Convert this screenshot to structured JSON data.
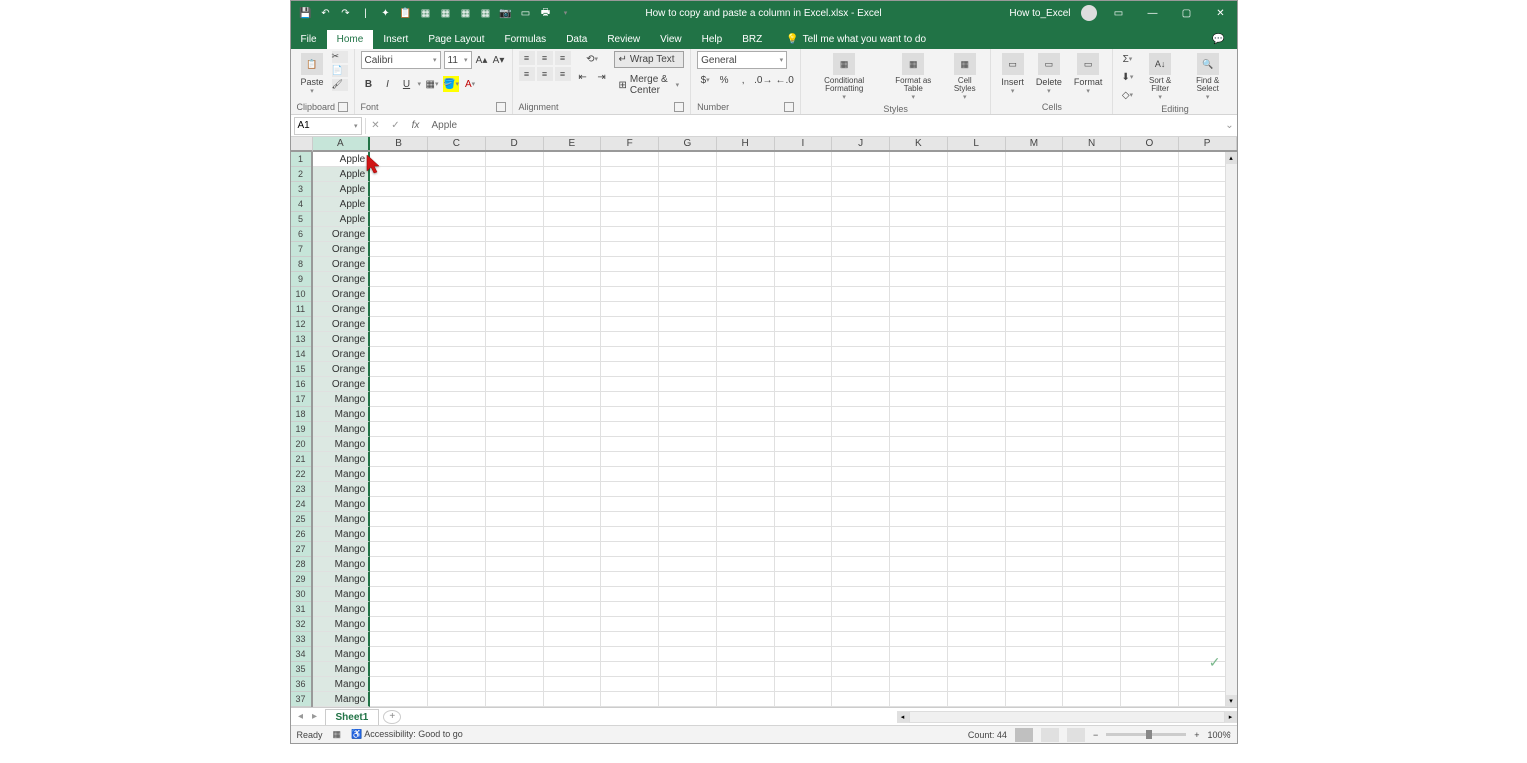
{
  "title_bar": {
    "document_title": "How to copy and paste a column in Excel.xlsx - Excel",
    "user_name": "How to_Excel"
  },
  "tabs": {
    "file": "File",
    "home": "Home",
    "insert": "Insert",
    "page_layout": "Page Layout",
    "formulas": "Formulas",
    "data": "Data",
    "review": "Review",
    "view": "View",
    "help": "Help",
    "brz": "BRZ",
    "tell_me": "Tell me what you want to do"
  },
  "ribbon": {
    "clipboard": {
      "label": "Clipboard",
      "paste": "Paste"
    },
    "font": {
      "label": "Font",
      "name": "Calibri",
      "size": "11",
      "bold": "B",
      "italic": "I",
      "underline": "U"
    },
    "alignment": {
      "label": "Alignment",
      "wrap_text": "Wrap Text",
      "merge_center": "Merge & Center"
    },
    "number": {
      "label": "Number",
      "format": "General"
    },
    "styles": {
      "label": "Styles",
      "conditional": "Conditional Formatting",
      "format_table": "Format as Table",
      "cell_styles": "Cell Styles"
    },
    "cells": {
      "label": "Cells",
      "insert": "Insert",
      "delete": "Delete",
      "format": "Format"
    },
    "editing": {
      "label": "Editing",
      "sort_filter": "Sort & Filter",
      "find_select": "Find & Select"
    }
  },
  "formula_bar": {
    "name_box": "A1",
    "fx": "fx",
    "formula": "Apple"
  },
  "columns": [
    "A",
    "B",
    "C",
    "D",
    "E",
    "F",
    "G",
    "H",
    "I",
    "J",
    "K",
    "L",
    "M",
    "N",
    "O",
    "P"
  ],
  "rows": [
    {
      "n": 1,
      "A": "Apple"
    },
    {
      "n": 2,
      "A": "Apple"
    },
    {
      "n": 3,
      "A": "Apple"
    },
    {
      "n": 4,
      "A": "Apple"
    },
    {
      "n": 5,
      "A": "Apple"
    },
    {
      "n": 6,
      "A": "Orange"
    },
    {
      "n": 7,
      "A": "Orange"
    },
    {
      "n": 8,
      "A": "Orange"
    },
    {
      "n": 9,
      "A": "Orange"
    },
    {
      "n": 10,
      "A": "Orange"
    },
    {
      "n": 11,
      "A": "Orange"
    },
    {
      "n": 12,
      "A": "Orange"
    },
    {
      "n": 13,
      "A": "Orange"
    },
    {
      "n": 14,
      "A": "Orange"
    },
    {
      "n": 15,
      "A": "Orange"
    },
    {
      "n": 16,
      "A": "Orange"
    },
    {
      "n": 17,
      "A": "Mango"
    },
    {
      "n": 18,
      "A": "Mango"
    },
    {
      "n": 19,
      "A": "Mango"
    },
    {
      "n": 20,
      "A": "Mango"
    },
    {
      "n": 21,
      "A": "Mango"
    },
    {
      "n": 22,
      "A": "Mango"
    },
    {
      "n": 23,
      "A": "Mango"
    },
    {
      "n": 24,
      "A": "Mango"
    },
    {
      "n": 25,
      "A": "Mango"
    },
    {
      "n": 26,
      "A": "Mango"
    },
    {
      "n": 27,
      "A": "Mango"
    },
    {
      "n": 28,
      "A": "Mango"
    },
    {
      "n": 29,
      "A": "Mango"
    },
    {
      "n": 30,
      "A": "Mango"
    },
    {
      "n": 31,
      "A": "Mango"
    },
    {
      "n": 32,
      "A": "Mango"
    },
    {
      "n": 33,
      "A": "Mango"
    },
    {
      "n": 34,
      "A": "Mango"
    },
    {
      "n": 35,
      "A": "Mango"
    },
    {
      "n": 36,
      "A": "Mango"
    },
    {
      "n": 37,
      "A": "Mango"
    }
  ],
  "sheet_tabs": {
    "sheet1": "Sheet1"
  },
  "status_bar": {
    "ready": "Ready",
    "accessibility": "Accessibility: Good to go",
    "count": "Count: 44",
    "zoom": "100%"
  }
}
